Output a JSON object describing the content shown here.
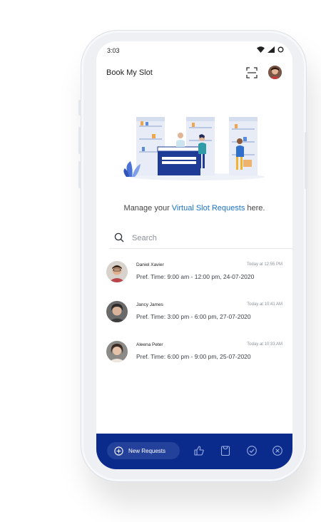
{
  "status_bar": {
    "time": "3:03"
  },
  "app_bar": {
    "title": "Book My Slot"
  },
  "intro": {
    "prefix": "Manage your ",
    "highlight": "Virtual Slot Requests",
    "suffix": " here."
  },
  "search": {
    "placeholder": "Search",
    "value": ""
  },
  "requests": [
    {
      "name": "Daniel Xavier",
      "time": "Today at 12:55 PM",
      "pref": "Pref. Time: 9:00 am - 12:00 pm, 24-07-2020"
    },
    {
      "name": "Jancy James",
      "time": "Today at 10:41 AM",
      "pref": "Pref. Time: 3:00 pm - 6:00 pm, 27-07-2020"
    },
    {
      "name": "Aleena Peter",
      "time": "Today at 10:33 AM",
      "pref": "Pref. Time: 6:00 pm - 9:00 pm, 25-07-2020"
    }
  ],
  "bottom_nav": {
    "new_requests_label": "New Requests",
    "icons": [
      "plus-circle-icon",
      "thumbs-up-icon",
      "bag-icon",
      "check-circle-icon",
      "cancel-circle-icon"
    ]
  },
  "colors": {
    "brand": "#0a2a8c",
    "accent_link": "#1a73c9",
    "pill": "#23409a"
  }
}
